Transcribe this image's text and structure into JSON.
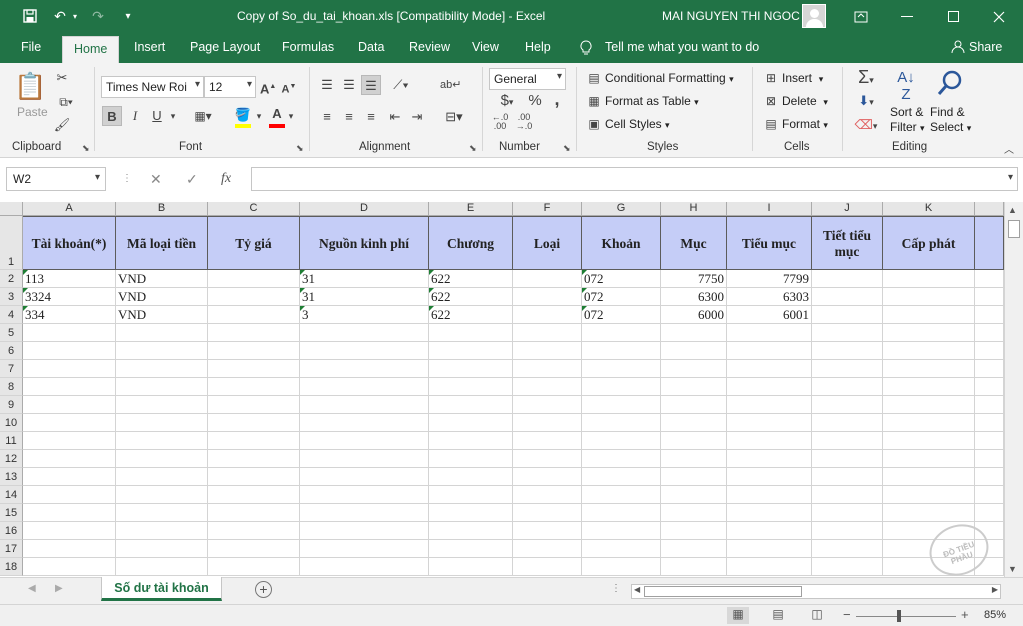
{
  "window": {
    "title": "Copy of So_du_tai_khoan.xls  [Compatibility Mode]  -  Excel",
    "user": "MAI NGUYEN THI NGOC"
  },
  "ribbon_tabs": [
    "File",
    "Home",
    "Insert",
    "Page Layout",
    "Formulas",
    "Data",
    "Review",
    "View",
    "Help"
  ],
  "active_tab": "Home",
  "tell_me": "Tell me what you want to do",
  "share": "Share",
  "clipboard": {
    "paste": "Paste",
    "label": "Clipboard"
  },
  "font": {
    "name": "Times New Roman",
    "name_shown": "Times New Roi",
    "size": "12",
    "bold": "B",
    "italic": "I",
    "underline": "U",
    "label": "Font",
    "font_color": "#ff0000",
    "fill_color": "#ffff00"
  },
  "alignment": {
    "label": "Alignment"
  },
  "number": {
    "format": "General",
    "currency": "$",
    "percent": "%",
    "comma": ",",
    "label": "Number"
  },
  "styles": {
    "conditional": "Conditional Formatting",
    "format_table": "Format as Table",
    "cell_styles": "Cell Styles",
    "label": "Styles"
  },
  "cells": {
    "insert": "Insert",
    "delete": "Delete",
    "format": "Format",
    "label": "Cells"
  },
  "editing": {
    "sort1": "Sort &",
    "sort2": "Filter",
    "find1": "Find &",
    "find2": "Select",
    "label": "Editing"
  },
  "formula_bar": {
    "name_box": "W2",
    "fx": "fx",
    "formula": ""
  },
  "columns": [
    "A",
    "B",
    "C",
    "D",
    "E",
    "F",
    "G",
    "H",
    "I",
    "J",
    "K"
  ],
  "rows": [
    "1",
    "2",
    "3",
    "4",
    "5",
    "6",
    "7",
    "8",
    "9",
    "10",
    "11",
    "12",
    "13",
    "14",
    "15",
    "16",
    "17",
    "18"
  ],
  "header_row": [
    "Tài khoản(*)",
    "Mã loại tiền",
    "Tỷ giá",
    "Nguồn kinh phí",
    "Chương",
    "Loại",
    "Khoản",
    "Mục",
    "Tiểu mục",
    "Tiết tiểu mục",
    "Cấp phát"
  ],
  "data_rows": [
    [
      "113",
      "VND",
      "",
      "31",
      "622",
      "",
      "072",
      "7750",
      "7799",
      "",
      ""
    ],
    [
      "3324",
      "VND",
      "",
      "31",
      "622",
      "",
      "072",
      "6300",
      "6303",
      "",
      ""
    ],
    [
      "334",
      "VND",
      "",
      "3",
      "622",
      "",
      "072",
      "6000",
      "6001",
      "",
      ""
    ]
  ],
  "sheet_tab": "Số dư tài khoản",
  "zoom": "85%",
  "colors": {
    "excel_green": "#217346",
    "header_fill": "#c5cdf7"
  }
}
